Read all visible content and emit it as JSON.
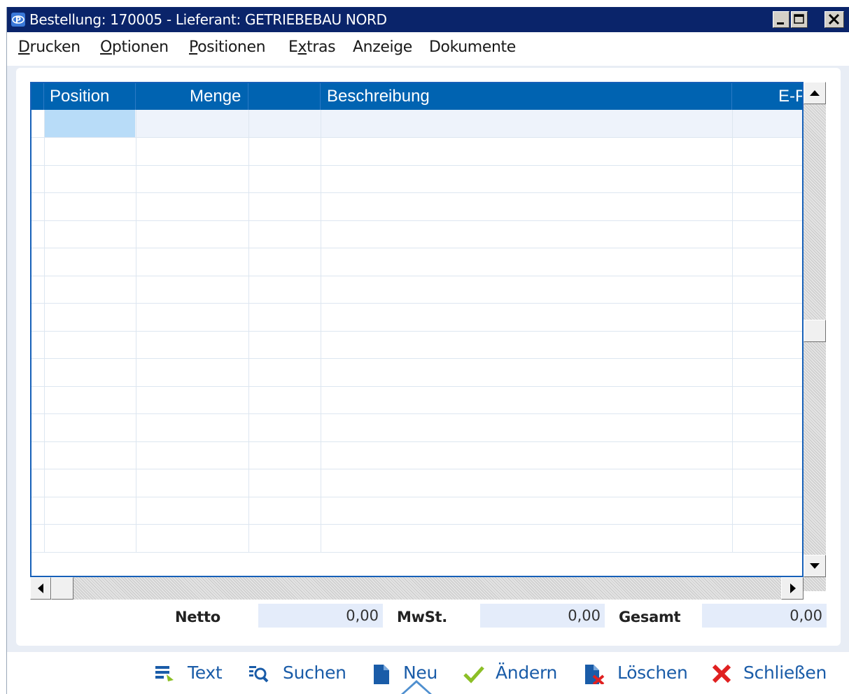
{
  "window": {
    "title": "Bestellung: 170005 - Lieferant: GETRIEBEBAU NORD",
    "controls": {
      "minimize": "_",
      "maximize": "□",
      "close": "✕"
    }
  },
  "menu": {
    "items": [
      {
        "mnemonic": "D",
        "rest": "rucken"
      },
      {
        "mnemonic": "O",
        "rest": "ptionen"
      },
      {
        "mnemonic": "P",
        "rest": "ositionen"
      },
      {
        "pre": "E",
        "mnemonic": "x",
        "rest": "tras"
      },
      {
        "plain": "Anzeige"
      },
      {
        "plain": "Dokumente"
      }
    ]
  },
  "grid": {
    "columns": [
      "Position",
      "Menge",
      "",
      "Beschreibung",
      "E-P"
    ],
    "rows": []
  },
  "totals": {
    "netto_label": "Netto",
    "netto_value": "0,00",
    "mwst_label": "MwSt.",
    "mwst_value": "0,00",
    "gesamt_label": "Gesamt",
    "gesamt_value": "0,00"
  },
  "toolbar": {
    "text": "Text",
    "suchen": "Suchen",
    "neu": "Neu",
    "aendern": "Ändern",
    "loeschen": "Löschen",
    "schliessen": "Schließen"
  },
  "icons": {
    "app": "app-logo-icon",
    "text": "text-edit-icon",
    "suchen": "search-icon",
    "neu": "new-document-icon",
    "aendern": "checkmark-icon",
    "loeschen": "delete-document-icon",
    "schliessen": "close-x-icon"
  },
  "colors": {
    "titlebar": "#0a246a",
    "grid_header": "#0063b1",
    "selected_cell": "#b8dcf8",
    "link_text": "#1a5ca8",
    "check_green": "#8cbf26",
    "close_red": "#e02020"
  }
}
